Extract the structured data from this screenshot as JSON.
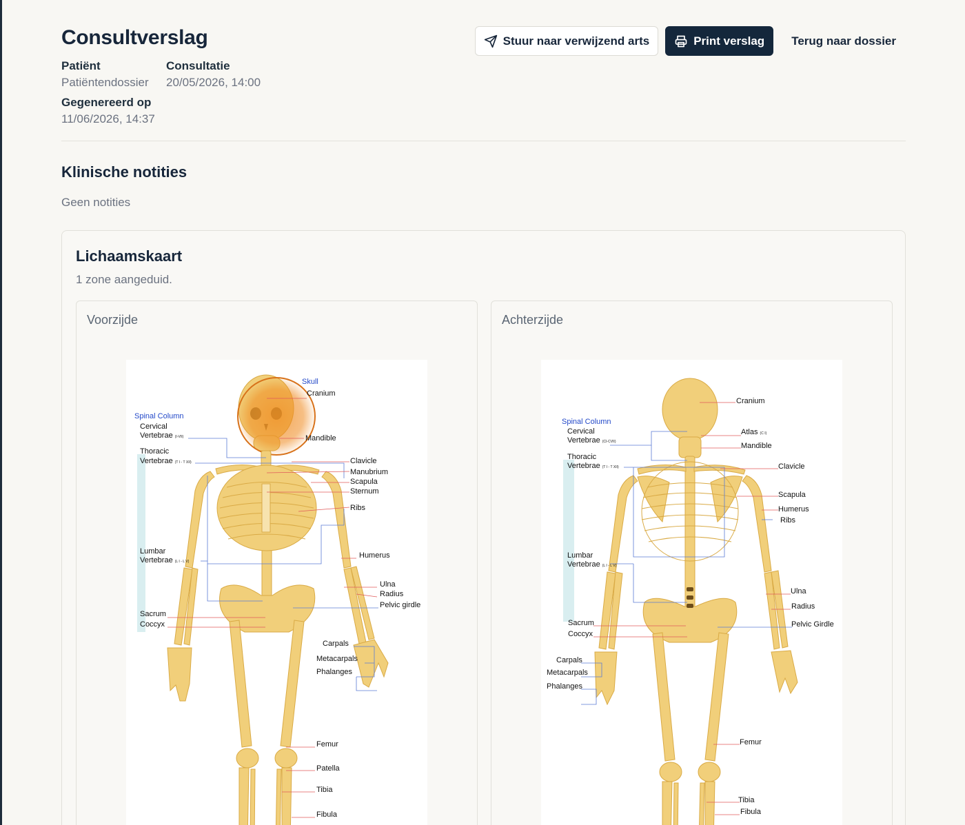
{
  "report": {
    "title": "Consultverslag",
    "patient_label": "Patiënt",
    "patient_value": "Patiëntendossier",
    "consult_label": "Consultatie",
    "consult_value": "20/05/2026, 14:00",
    "generated_label": "Gegenereerd op",
    "generated_value": "11/06/2026, 14:37"
  },
  "actions": {
    "send_label": "Stuur naar verwijzend arts",
    "print_label": "Print verslag",
    "back_label": "Terug naar dossier",
    "send_icon": "send-icon",
    "print_icon": "printer-icon"
  },
  "notes": {
    "title": "Klinische notities",
    "empty_text": "Geen notities"
  },
  "body_map": {
    "title": "Lichaamskaart",
    "summary": "1 zone aangeduid.",
    "highlight_color": "#ef8a1f",
    "front": {
      "label": "Voorzijde",
      "highlighted_zone": "Skull",
      "labels": {
        "skull": "Skull",
        "cranium": "Cranium",
        "spinal_column": "Spinal Column",
        "cervical": "Cervical",
        "cervical_vert": "Vertebrae",
        "cervical_range": "(I-VII)",
        "mandible": "Mandible",
        "thoracic": "Thoracic",
        "thoracic_vert": "Vertebrae",
        "thoracic_range": "(T I - T XII)",
        "clavicle": "Clavicle",
        "manubrium": "Manubrium",
        "scapula": "Scapula",
        "sternum": "Sternum",
        "ribs": "Ribs",
        "lumbar": "Lumbar",
        "lumbar_vert": "Vertebrae",
        "lumbar_range": "(L I - L V)",
        "humerus": "Humerus",
        "ulna": "Ulna",
        "radius": "Radius",
        "pelvic_girdle": "Pelvic girdle",
        "sacrum": "Sacrum",
        "coccyx": "Coccyx",
        "carpals": "Carpals",
        "metacarpals": "Metacarpals",
        "phalanges": "Phalanges",
        "femur": "Femur",
        "patella": "Patella",
        "tibia": "Tibia",
        "fibula": "Fibula"
      }
    },
    "back": {
      "label": "Achterzijde",
      "labels": {
        "cranium": "Cranium",
        "spinal_column": "Spinal Column",
        "cervical": "Cervical",
        "cervical_vert": "Vertebrae",
        "cervical_range": "(CI-CVII)",
        "atlas": "Atlas",
        "atlas_sub": "(C I)",
        "mandible": "Mandible",
        "thoracic": "Thoracic",
        "thoracic_vert": "Vertebrae",
        "thoracic_range": "(T I - T XII)",
        "clavicle": "Clavicle",
        "scapula": "Scapula",
        "humerus": "Humerus",
        "ribs": "Ribs",
        "lumbar": "Lumbar",
        "lumbar_vert": "Vertebrae",
        "lumbar_range": "(L I - L V)",
        "ulna": "Ulna",
        "radius": "Radius",
        "sacrum": "Sacrum",
        "pelvic_girdle": "Pelvic Girdle",
        "coccyx": "Coccyx",
        "carpals": "Carpals",
        "metacarpals": "Metacarpals",
        "phalanges": "Phalanges",
        "femur": "Femur",
        "tibia": "Tibia",
        "fibula": "Fibula"
      }
    }
  }
}
